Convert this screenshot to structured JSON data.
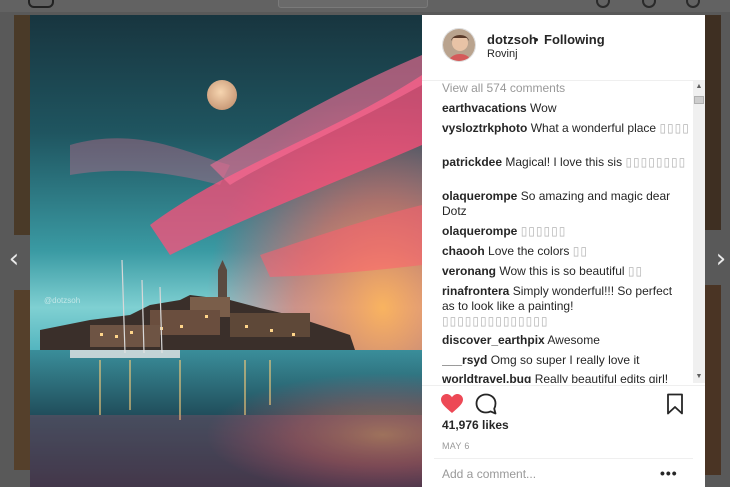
{
  "post": {
    "username": "dotzsoh",
    "separator": "•",
    "follow_status": "Following",
    "location": "Rovinj",
    "watermark": "@dotzsoh",
    "view_all": "View all 574 comments",
    "comments": [
      {
        "user": "earthvacations",
        "text": "Wow",
        "boxes": ""
      },
      {
        "user": "vysloztrkphoto",
        "text": "What a wonderful place",
        "boxes": "▯▯▯▯"
      },
      {
        "user": "patrickdee",
        "text": "Magical! I love this sis",
        "boxes": "▯▯▯▯▯▯▯▯"
      },
      {
        "user": "olaquerompe",
        "text": "So amazing and magic dear Dotz",
        "boxes": ""
      },
      {
        "user": "olaquerompe",
        "text": "",
        "boxes": "▯▯▯▯▯▯"
      },
      {
        "user": "chaooh",
        "text": "Love the colors",
        "boxes": "▯▯"
      },
      {
        "user": "veronang",
        "text": "Wow this is so beautiful",
        "boxes": "▯▯"
      },
      {
        "user": "rinafrontera",
        "text": "Simply wonderful!!! So perfect as to look like a painting!",
        "boxes": "▯▯▯▯▯▯▯▯▯▯▯▯▯▯"
      },
      {
        "user": "discover_earthpix",
        "text": "Awesome",
        "boxes": ""
      },
      {
        "user": "___rsyd",
        "text": "Omg so super I really love it",
        "boxes": ""
      },
      {
        "user": "worldtravel.bug",
        "text": "Really beautiful edits girl!",
        "boxes": ""
      }
    ],
    "likes": "41,976 likes",
    "date": "MAY 6",
    "add_comment_placeholder": "Add a comment...",
    "more_label": "•••"
  },
  "nav": {
    "prev": "‹",
    "next": "›"
  },
  "colors": {
    "heart": "#ed4956",
    "text": "#262626",
    "muted": "#999999"
  }
}
